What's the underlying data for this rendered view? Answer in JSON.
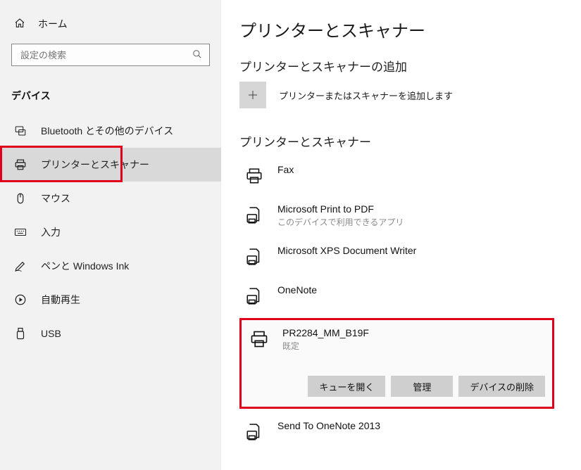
{
  "sidebar": {
    "home_label": "ホーム",
    "search_placeholder": "設定の検索",
    "section_header": "デバイス",
    "items": [
      {
        "label": "Bluetooth とその他のデバイス"
      },
      {
        "label": "プリンターとスキャナー"
      },
      {
        "label": "マウス"
      },
      {
        "label": "入力"
      },
      {
        "label": "ペンと Windows Ink"
      },
      {
        "label": "自動再生"
      },
      {
        "label": "USB"
      }
    ]
  },
  "main": {
    "page_title": "プリンターとスキャナー",
    "add_section_title": "プリンターとスキャナーの追加",
    "add_text": "プリンターまたはスキャナーを追加します",
    "list_section_title": "プリンターとスキャナー",
    "devices": [
      {
        "name": "Fax"
      },
      {
        "name": "Microsoft Print to PDF",
        "sub": "このデバイスで利用できるアプリ"
      },
      {
        "name": "Microsoft XPS Document Writer"
      },
      {
        "name": "OneNote"
      }
    ],
    "selected_device": {
      "name": "PR2284_MM_B19F",
      "sub": "既定",
      "actions": {
        "open_queue": "キューを開く",
        "manage": "管理",
        "remove": "デバイスの削除"
      }
    },
    "after_devices": [
      {
        "name": "Send To OneNote 2013"
      }
    ]
  }
}
